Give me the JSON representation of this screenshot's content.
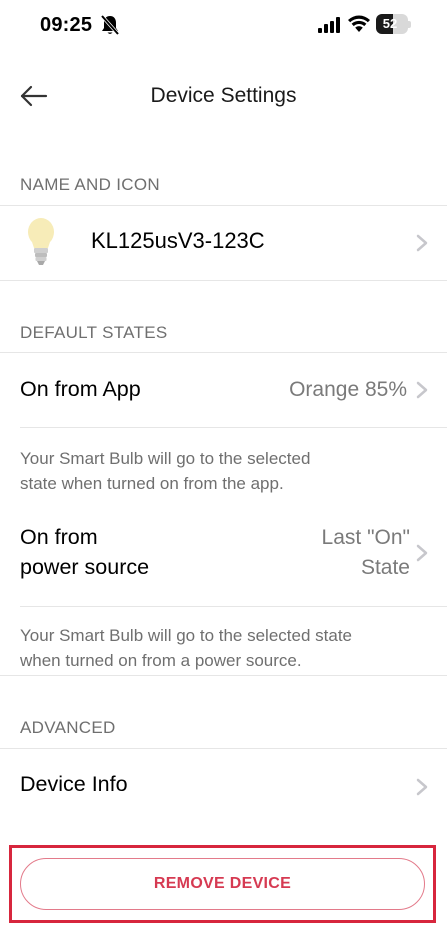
{
  "status_bar": {
    "time": "09:25",
    "battery_level": "52",
    "battery_fraction": 0.52,
    "icons": [
      "bell-slash-icon",
      "signal-bars-icon",
      "wifi-icon",
      "battery-icon"
    ]
  },
  "nav": {
    "back_icon": "arrow-left-icon",
    "title": "Device Settings"
  },
  "sections": {
    "name_and_icon": "NAME AND ICON",
    "default_states": "DEFAULT STATES",
    "advanced": "ADVANCED"
  },
  "device": {
    "icon": "light-bulb-icon",
    "name": "KL125usV3-123C"
  },
  "default_states": {
    "on_from_app_label": "On from App",
    "on_from_app_value": "Orange 85%",
    "on_from_app_note_line1": "Your Smart Bulb will go to the selected",
    "on_from_app_note_line2": "state when turned on from the app.",
    "on_from_power_label_line1": "On from",
    "on_from_power_label_line2": "power source",
    "on_from_power_value_line1": "Last \"On\"",
    "on_from_power_value_line2": "State",
    "on_from_power_note_line1": "Your Smart Bulb will go to the selected state",
    "on_from_power_note_line2": "when turned on from a power source."
  },
  "advanced": {
    "device_info_label": "Device Info"
  },
  "actions": {
    "remove_device": "REMOVE DEVICE"
  },
  "colors": {
    "accent": "#d63a52",
    "highlight_frame": "#d7263d",
    "secondary_text": "#6f6f6f",
    "value_text": "#7a7a7a",
    "chevron": "#c7c7cc"
  }
}
